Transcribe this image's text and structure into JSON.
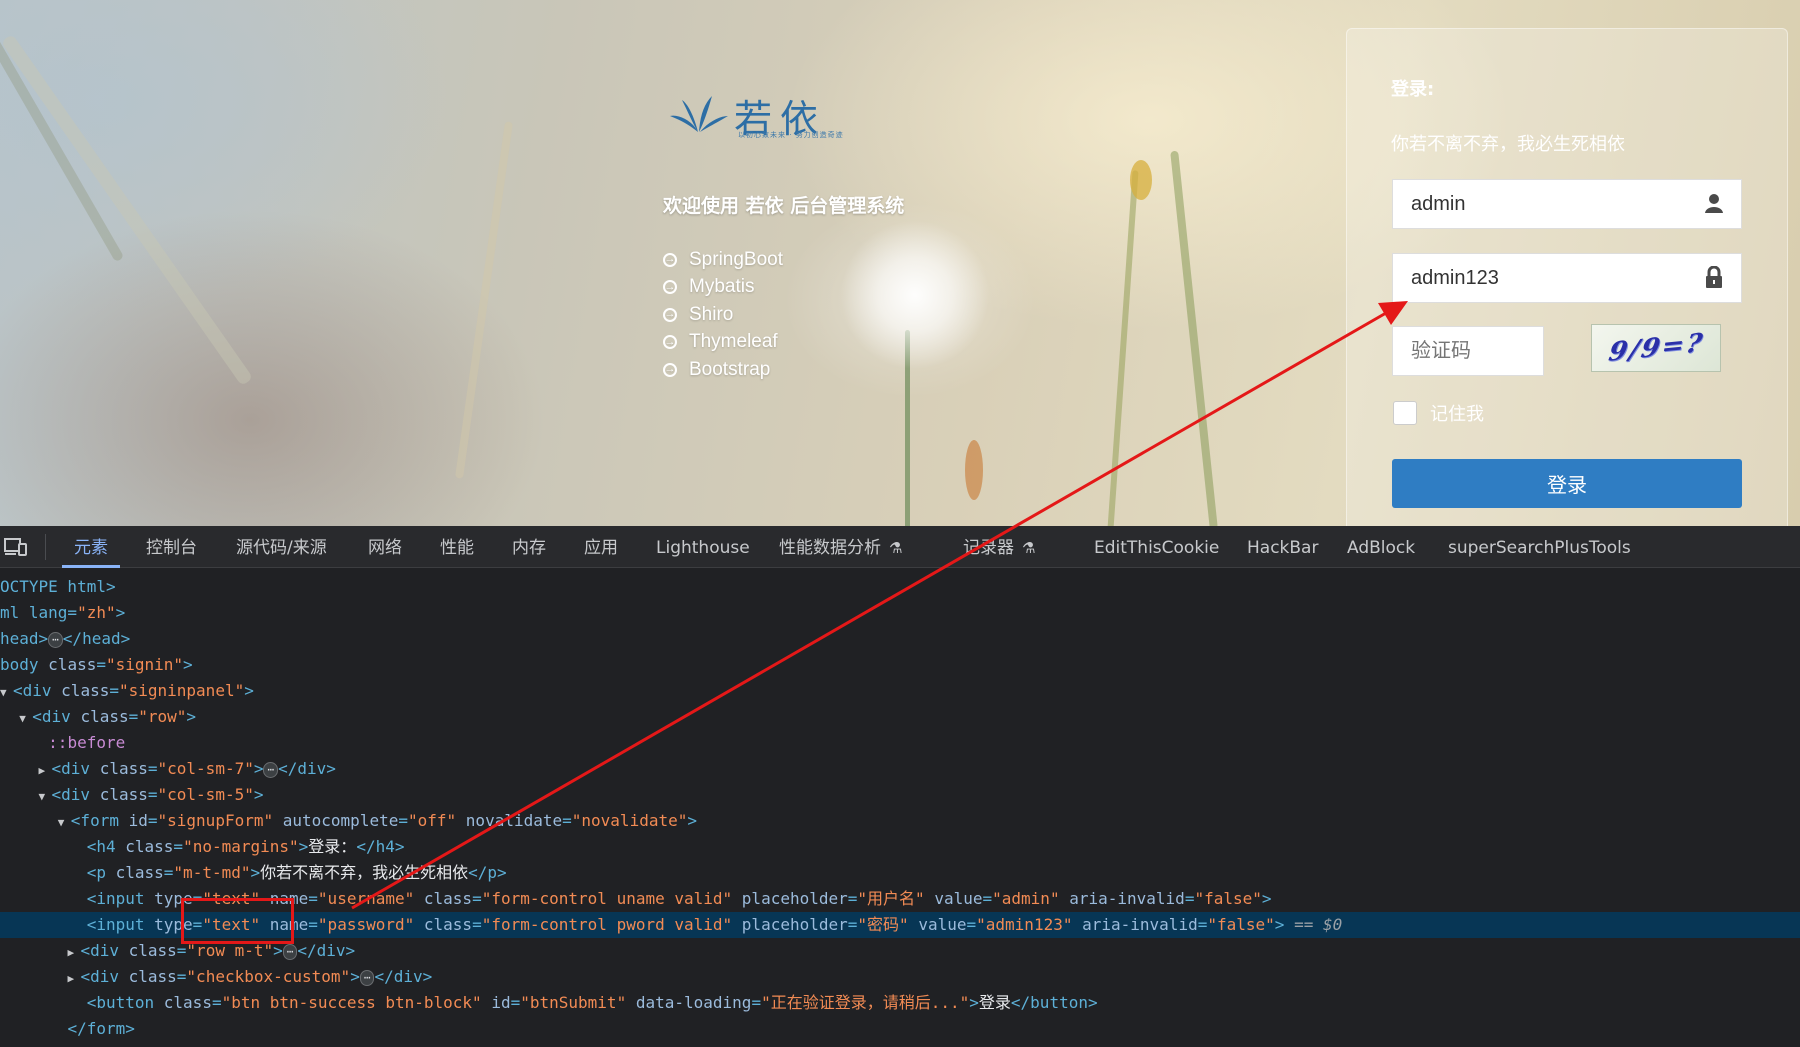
{
  "login": {
    "brand_name": "若依",
    "brand_tagline": "以初心致未来 · 努力创造奇迹",
    "welcome": "欢迎使用 若依 后台管理系统",
    "tech_list": [
      "SpringBoot",
      "Mybatis",
      "Shiro",
      "Thymeleaf",
      "Bootstrap"
    ],
    "form": {
      "title": "登录:",
      "motto": "你若不离不弃，我必生死相依",
      "username_value": "admin",
      "username_placeholder": "用户名",
      "password_value": "admin123",
      "password_placeholder": "密码",
      "captcha_placeholder": "验证码",
      "captcha_text": "9/9=?",
      "remember_label": "记住我",
      "submit_label": "登录"
    }
  },
  "devtools": {
    "tabs": [
      "元素",
      "控制台",
      "源代码/来源",
      "网络",
      "性能",
      "内存",
      "应用",
      "Lighthouse",
      "性能数据分析",
      "记录器",
      "EditThisCookie",
      "HackBar",
      "AdBlock",
      "superSearchPlusTools"
    ],
    "active_tab": "元素",
    "source": {
      "doctype": "OCTYPE html>",
      "html_open": "ml lang=",
      "lang": "\"zh\"",
      "head_open": "head>",
      "head_close": "</head>",
      "body_tag": "body",
      "body_class": "\"signin\"",
      "panel_class": "\"signinpanel\"",
      "row_class": "\"row\"",
      "before": "::before",
      "col7_class": "\"col-sm-7\"",
      "col5_class": "\"col-sm-5\"",
      "form_id": "\"signupForm\"",
      "form_autocomplete": "\"off\"",
      "form_novalidate": "\"novalidate\"",
      "h4_class": "\"no-margins\"",
      "h4_text": "登录：",
      "p_class": "\"m-t-md\"",
      "p_text": "你若不离不弃，我必生死相依",
      "input1_type": "\"text\"",
      "input1_name": "\"username\"",
      "input1_class": "\"form-control uname valid\"",
      "input1_placeholder": "\"用户名\"",
      "input1_value": "\"admin\"",
      "input1_aria": "\"false\"",
      "input2_type": "\"text\"",
      "input2_name": "\"password\"",
      "input2_class": "\"form-control pword valid\"",
      "input2_placeholder": "\"密码\"",
      "input2_value": "\"admin123\"",
      "input2_aria": "\"false\"",
      "selected_marker": "== $0",
      "row_mt_class": "\"row m-t\"",
      "checkbox_class": "\"checkbox-custom\"",
      "btn_class": "\"btn btn-success btn-block\"",
      "btn_id": "\"btnSubmit\"",
      "btn_loading": "\"正在验证登录，请稍后...\"",
      "btn_text": "登录",
      "form_close": "</form>"
    }
  },
  "annotation": {
    "color": "#e41818"
  }
}
